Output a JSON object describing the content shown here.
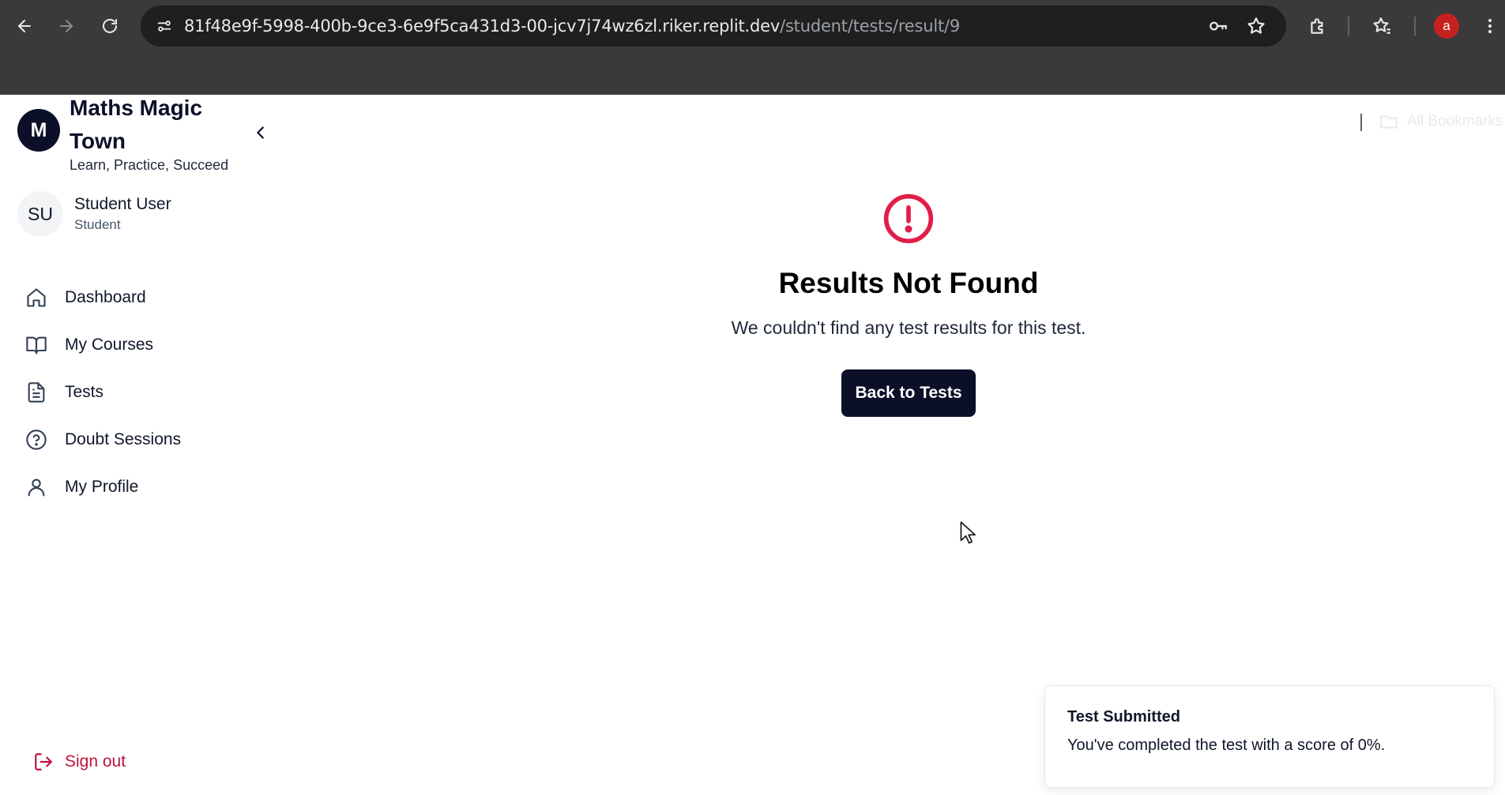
{
  "browser": {
    "url_host": "81f48e9f-5998-400b-9ce3-6e9f5ca431d3-00-jcv7j74wz6zl.riker.replit.dev",
    "url_path": "/student/tests/result/9",
    "profile_initial": "a",
    "bookmarks_label": "All Bookmarks"
  },
  "sidebar": {
    "logo_letter": "M",
    "brand_name": "Maths Magic Town",
    "tagline": "Learn, Practice, Succeed",
    "user": {
      "initials": "SU",
      "name": "Student User",
      "role": "Student"
    },
    "items": [
      {
        "label": "Dashboard",
        "icon": "home-icon"
      },
      {
        "label": "My Courses",
        "icon": "book-open-icon"
      },
      {
        "label": "Tests",
        "icon": "file-text-icon"
      },
      {
        "label": "Doubt Sessions",
        "icon": "help-circle-icon"
      },
      {
        "label": "My Profile",
        "icon": "user-icon"
      }
    ],
    "sign_out_label": "Sign out"
  },
  "main": {
    "icon": "alert-circle-icon",
    "title": "Results Not Found",
    "message": "We couldn't find any test results for this test.",
    "back_button_label": "Back to Tests"
  },
  "toast": {
    "title": "Test Submitted",
    "description": "You've completed the test with a score of 0%."
  },
  "colors": {
    "chrome": "#3a3a3a",
    "primary_dark": "#0b1028",
    "alert_red": "#e11d48",
    "sign_out_red": "#be123c"
  }
}
